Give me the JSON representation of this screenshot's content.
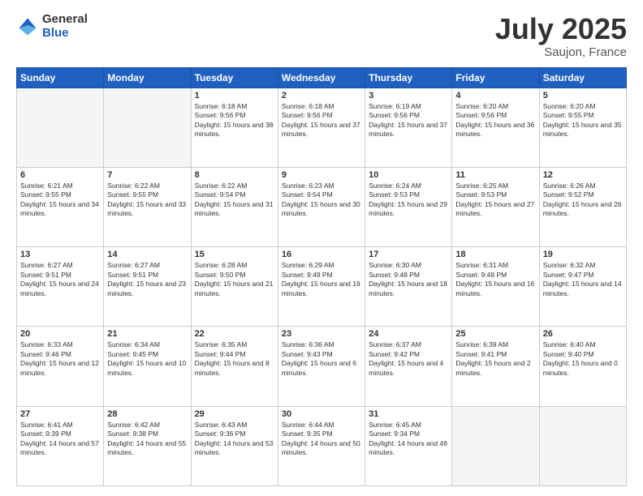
{
  "header": {
    "logo_general": "General",
    "logo_blue": "Blue",
    "title": "July 2025",
    "location": "Saujon, France"
  },
  "days_of_week": [
    "Sunday",
    "Monday",
    "Tuesday",
    "Wednesday",
    "Thursday",
    "Friday",
    "Saturday"
  ],
  "weeks": [
    [
      {
        "day": "",
        "empty": true
      },
      {
        "day": "",
        "empty": true
      },
      {
        "day": "1",
        "sunrise": "6:18 AM",
        "sunset": "9:56 PM",
        "daylight": "15 hours and 38 minutes."
      },
      {
        "day": "2",
        "sunrise": "6:18 AM",
        "sunset": "9:56 PM",
        "daylight": "15 hours and 37 minutes."
      },
      {
        "day": "3",
        "sunrise": "6:19 AM",
        "sunset": "9:56 PM",
        "daylight": "15 hours and 37 minutes."
      },
      {
        "day": "4",
        "sunrise": "6:20 AM",
        "sunset": "9:56 PM",
        "daylight": "15 hours and 36 minutes."
      },
      {
        "day": "5",
        "sunrise": "6:20 AM",
        "sunset": "9:55 PM",
        "daylight": "15 hours and 35 minutes."
      }
    ],
    [
      {
        "day": "6",
        "sunrise": "6:21 AM",
        "sunset": "9:55 PM",
        "daylight": "15 hours and 34 minutes."
      },
      {
        "day": "7",
        "sunrise": "6:22 AM",
        "sunset": "9:55 PM",
        "daylight": "15 hours and 33 minutes."
      },
      {
        "day": "8",
        "sunrise": "6:22 AM",
        "sunset": "9:54 PM",
        "daylight": "15 hours and 31 minutes."
      },
      {
        "day": "9",
        "sunrise": "6:23 AM",
        "sunset": "9:54 PM",
        "daylight": "15 hours and 30 minutes."
      },
      {
        "day": "10",
        "sunrise": "6:24 AM",
        "sunset": "9:53 PM",
        "daylight": "15 hours and 29 minutes."
      },
      {
        "day": "11",
        "sunrise": "6:25 AM",
        "sunset": "9:53 PM",
        "daylight": "15 hours and 27 minutes."
      },
      {
        "day": "12",
        "sunrise": "6:26 AM",
        "sunset": "9:52 PM",
        "daylight": "15 hours and 26 minutes."
      }
    ],
    [
      {
        "day": "13",
        "sunrise": "6:27 AM",
        "sunset": "9:51 PM",
        "daylight": "15 hours and 24 minutes."
      },
      {
        "day": "14",
        "sunrise": "6:27 AM",
        "sunset": "9:51 PM",
        "daylight": "15 hours and 23 minutes."
      },
      {
        "day": "15",
        "sunrise": "6:28 AM",
        "sunset": "9:50 PM",
        "daylight": "15 hours and 21 minutes."
      },
      {
        "day": "16",
        "sunrise": "6:29 AM",
        "sunset": "9:49 PM",
        "daylight": "15 hours and 19 minutes."
      },
      {
        "day": "17",
        "sunrise": "6:30 AM",
        "sunset": "9:48 PM",
        "daylight": "15 hours and 18 minutes."
      },
      {
        "day": "18",
        "sunrise": "6:31 AM",
        "sunset": "9:48 PM",
        "daylight": "15 hours and 16 minutes."
      },
      {
        "day": "19",
        "sunrise": "6:32 AM",
        "sunset": "9:47 PM",
        "daylight": "15 hours and 14 minutes."
      }
    ],
    [
      {
        "day": "20",
        "sunrise": "6:33 AM",
        "sunset": "9:46 PM",
        "daylight": "15 hours and 12 minutes."
      },
      {
        "day": "21",
        "sunrise": "6:34 AM",
        "sunset": "9:45 PM",
        "daylight": "15 hours and 10 minutes."
      },
      {
        "day": "22",
        "sunrise": "6:35 AM",
        "sunset": "9:44 PM",
        "daylight": "15 hours and 8 minutes."
      },
      {
        "day": "23",
        "sunrise": "6:36 AM",
        "sunset": "9:43 PM",
        "daylight": "15 hours and 6 minutes."
      },
      {
        "day": "24",
        "sunrise": "6:37 AM",
        "sunset": "9:42 PM",
        "daylight": "15 hours and 4 minutes."
      },
      {
        "day": "25",
        "sunrise": "6:39 AM",
        "sunset": "9:41 PM",
        "daylight": "15 hours and 2 minutes."
      },
      {
        "day": "26",
        "sunrise": "6:40 AM",
        "sunset": "9:40 PM",
        "daylight": "15 hours and 0 minutes."
      }
    ],
    [
      {
        "day": "27",
        "sunrise": "6:41 AM",
        "sunset": "9:39 PM",
        "daylight": "14 hours and 57 minutes."
      },
      {
        "day": "28",
        "sunrise": "6:42 AM",
        "sunset": "9:38 PM",
        "daylight": "14 hours and 55 minutes."
      },
      {
        "day": "29",
        "sunrise": "6:43 AM",
        "sunset": "9:36 PM",
        "daylight": "14 hours and 53 minutes."
      },
      {
        "day": "30",
        "sunrise": "6:44 AM",
        "sunset": "9:35 PM",
        "daylight": "14 hours and 50 minutes."
      },
      {
        "day": "31",
        "sunrise": "6:45 AM",
        "sunset": "9:34 PM",
        "daylight": "14 hours and 48 minutes."
      },
      {
        "day": "",
        "empty": true
      },
      {
        "day": "",
        "empty": true
      }
    ]
  ]
}
